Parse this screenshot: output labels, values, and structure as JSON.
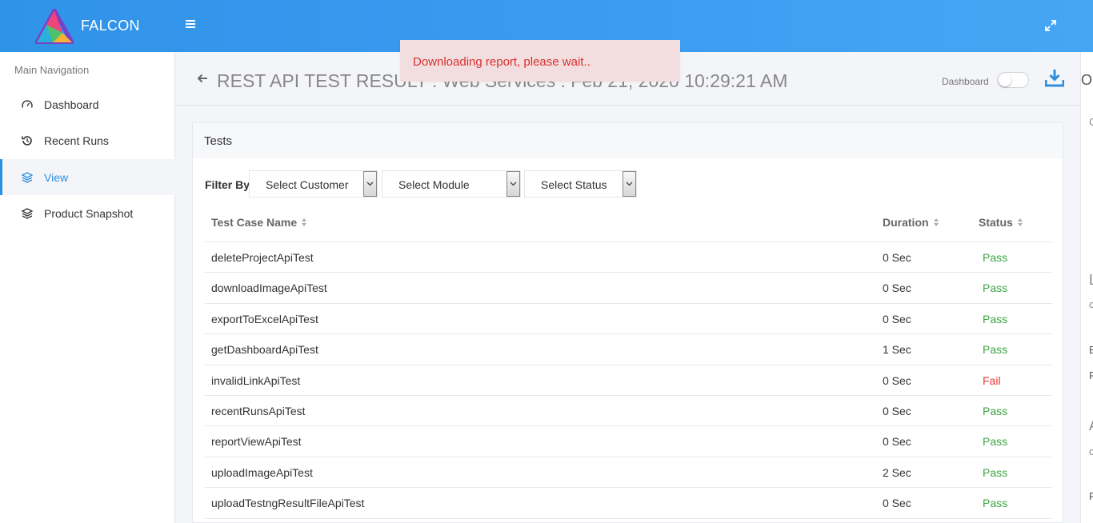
{
  "app": {
    "brand": "FALCON"
  },
  "colors": {
    "accent": "#2d8fe0",
    "topbar": "#3a9af0",
    "pass": "#3aa53f",
    "fail": "#e53935",
    "toast_bg": "#f2dede",
    "toast_text": "#d9302f"
  },
  "sidebar": {
    "heading": "Main Navigation",
    "items": [
      {
        "label": "Dashboard",
        "icon": "speedometer-icon"
      },
      {
        "label": "Recent Runs",
        "icon": "history-icon"
      },
      {
        "label": "View",
        "icon": "layers-icon",
        "active": true
      },
      {
        "label": "Product Snapshot",
        "icon": "layers-icon"
      }
    ]
  },
  "header": {
    "title": "REST API TEST RESULT : Web Services : Feb 21, 2020 10:29:21 AM",
    "dashboard_label": "Dashboard",
    "dashboard_toggle": false
  },
  "toast": {
    "message": "Downloading report, please wait.."
  },
  "tests": {
    "card_title": "Tests",
    "filter_label": "Filter By",
    "filters": {
      "customer": "Select Customer",
      "module": "Select Module",
      "status": "Select Status"
    },
    "columns": {
      "name": "Test Case Name",
      "duration": "Duration",
      "status": "Status"
    },
    "rows": [
      {
        "name": "deleteProjectApiTest",
        "duration": "0 Sec",
        "status": "Pass"
      },
      {
        "name": "downloadImageApiTest",
        "duration": "0 Sec",
        "status": "Pass"
      },
      {
        "name": "exportToExcelApiTest",
        "duration": "0 Sec",
        "status": "Pass"
      },
      {
        "name": "getDashboardApiTest",
        "duration": "1 Sec",
        "status": "Pass"
      },
      {
        "name": "invalidLinkApiTest",
        "duration": "0 Sec",
        "status": "Fail"
      },
      {
        "name": "recentRunsApiTest",
        "duration": "0 Sec",
        "status": "Pass"
      },
      {
        "name": "reportViewApiTest",
        "duration": "0 Sec",
        "status": "Pass"
      },
      {
        "name": "uploadImageApiTest",
        "duration": "2 Sec",
        "status": "Pass"
      },
      {
        "name": "uploadTestngResultFileApiTest",
        "duration": "0 Sec",
        "status": "Pass"
      }
    ]
  },
  "right_panel_fragments": [
    "O",
    "C",
    "L",
    "c",
    "B",
    "R",
    "A",
    "c",
    "F"
  ]
}
